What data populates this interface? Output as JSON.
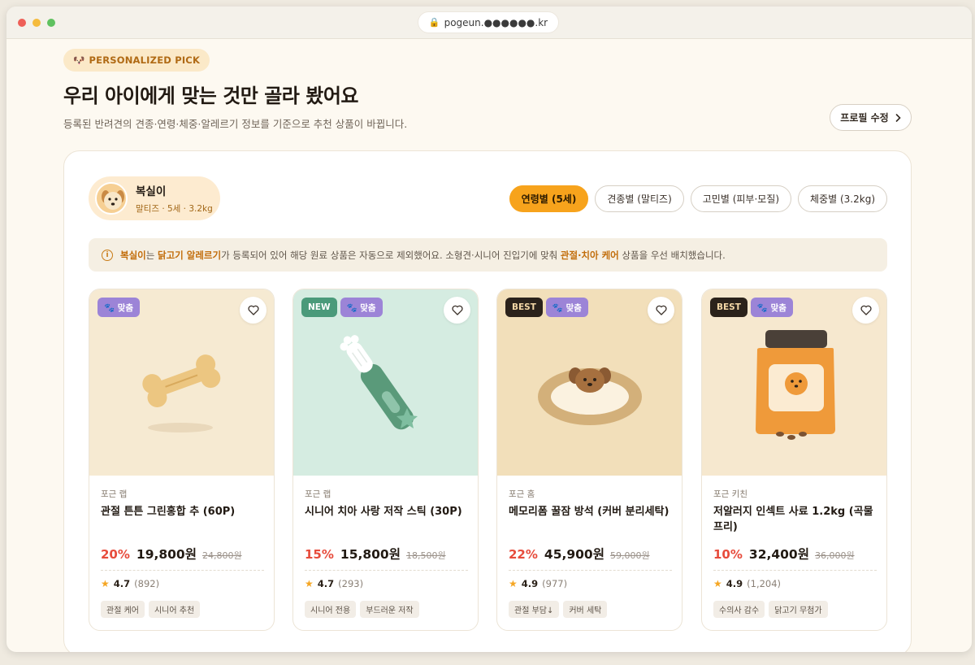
{
  "browser": {
    "url": "pogeun.●●●●●●.kr"
  },
  "hero": {
    "tag": "PERSONALIZED PICK",
    "title": "우리 아이에게 맞는 것만 골라 봤어요",
    "subtitle": "등록된 반려견의 견종·연령·체중·알레르기 정보를 기준으로 추천 상품이 바뀝니다.",
    "edit_label": "프로필 수정"
  },
  "pet": {
    "name": "복실이",
    "meta": "말티즈 · 5세 · 3.2kg"
  },
  "filters": [
    {
      "label": "연령별 (5세)",
      "active": true
    },
    {
      "label": "견종별 (말티즈)",
      "active": false
    },
    {
      "label": "고민별 (피부·모질)",
      "active": false
    },
    {
      "label": "체중별 (3.2kg)",
      "active": false
    }
  ],
  "notice": {
    "pet_name": "복실이",
    "part1": "는 ",
    "allergy": "닭고기 알레르기",
    "part2": "가 등록되어 있어 해당 원료 상품은 자동으로 제외했어요. 소형견·시니어 진입기에 맞춰 ",
    "care": "관절·치아 케어",
    "part3": " 상품을 우선 배치했습니다."
  },
  "products": [
    {
      "badges": [
        {
          "type": "match",
          "label": "🐾 맞춤"
        }
      ],
      "brand": "포근 랩",
      "name": "관절 튼튼 그린홍합 추 (60P)",
      "discount": "20%",
      "price": "19,800원",
      "original": "24,800원",
      "rating": "4.7",
      "reviews": "(892)",
      "tags": [
        "관절 케어",
        "시니어 추천"
      ],
      "bg": "#f6ead2"
    },
    {
      "badges": [
        {
          "type": "new",
          "label": "NEW"
        },
        {
          "type": "match",
          "label": "🐾 맞춤"
        }
      ],
      "brand": "포근 랩",
      "name": "시니어 치아 사랑 저작 스틱 (30P)",
      "discount": "15%",
      "price": "15,800원",
      "original": "18,500원",
      "rating": "4.7",
      "reviews": "(293)",
      "tags": [
        "시니어 전용",
        "부드러운 저작"
      ],
      "bg": "#d5ece1"
    },
    {
      "badges": [
        {
          "type": "best",
          "label": "BEST"
        },
        {
          "type": "match",
          "label": "🐾 맞춤"
        }
      ],
      "brand": "포근 홈",
      "name": "메모리폼 꿀잠 방석 (커버 분리세탁)",
      "discount": "22%",
      "price": "45,900원",
      "original": "59,000원",
      "rating": "4.9",
      "reviews": "(977)",
      "tags": [
        "관절 부담↓",
        "커버 세탁"
      ],
      "bg": "#f2dfba"
    },
    {
      "badges": [
        {
          "type": "best",
          "label": "BEST"
        },
        {
          "type": "match",
          "label": "🐾 맞춤"
        }
      ],
      "brand": "포근 키친",
      "name": "저알러지 인섹트 사료 1.2kg (곡물 프리)",
      "discount": "10%",
      "price": "32,400원",
      "original": "36,000원",
      "rating": "4.9",
      "reviews": "(1,204)",
      "tags": [
        "수의사 감수",
        "닭고기 무첨가"
      ],
      "bg": "#f6e8cf"
    }
  ],
  "colors": {
    "accent": "#f7a31c",
    "discount": "#e74c3c",
    "match_badge": "#9c84d7"
  },
  "icons": {
    "heart": "heart-icon",
    "star": "star-icon",
    "info": "info-icon",
    "chevron": "chevron-right-icon",
    "lock": "lock-icon",
    "paw": "paw-icon"
  }
}
